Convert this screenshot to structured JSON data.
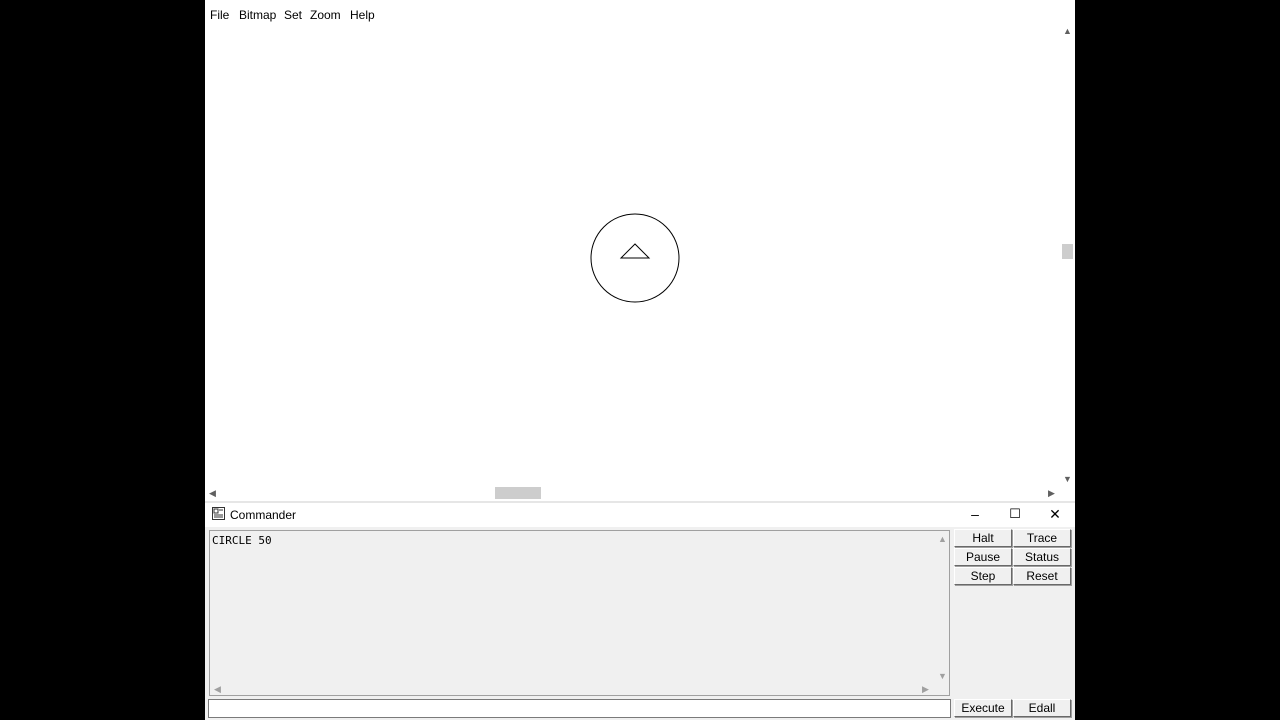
{
  "menu": {
    "items": [
      "File",
      "Bitmap",
      "Set",
      "Zoom",
      "Help"
    ]
  },
  "commander": {
    "title": "Commander",
    "output_lines": "CIRCLE 50",
    "input_value": "",
    "buttons": {
      "halt": "Halt",
      "trace": "Trace",
      "pause": "Pause",
      "status": "Status",
      "step": "Step",
      "reset": "Reset",
      "execute": "Execute",
      "edall": "Edall"
    },
    "window_controls": {
      "minimize": "–",
      "maximize": "☐",
      "close": "✕"
    }
  },
  "scroll": {
    "up": "⌃",
    "down": "⌄",
    "left": "‹",
    "right": "›"
  },
  "icons": {
    "commander_icon": "commander-window-icon",
    "turtle": "triangle-turtle-icon"
  },
  "colors": {
    "canvas": "#ffffff",
    "panel": "#f0f0f0",
    "frame": "#000000"
  }
}
